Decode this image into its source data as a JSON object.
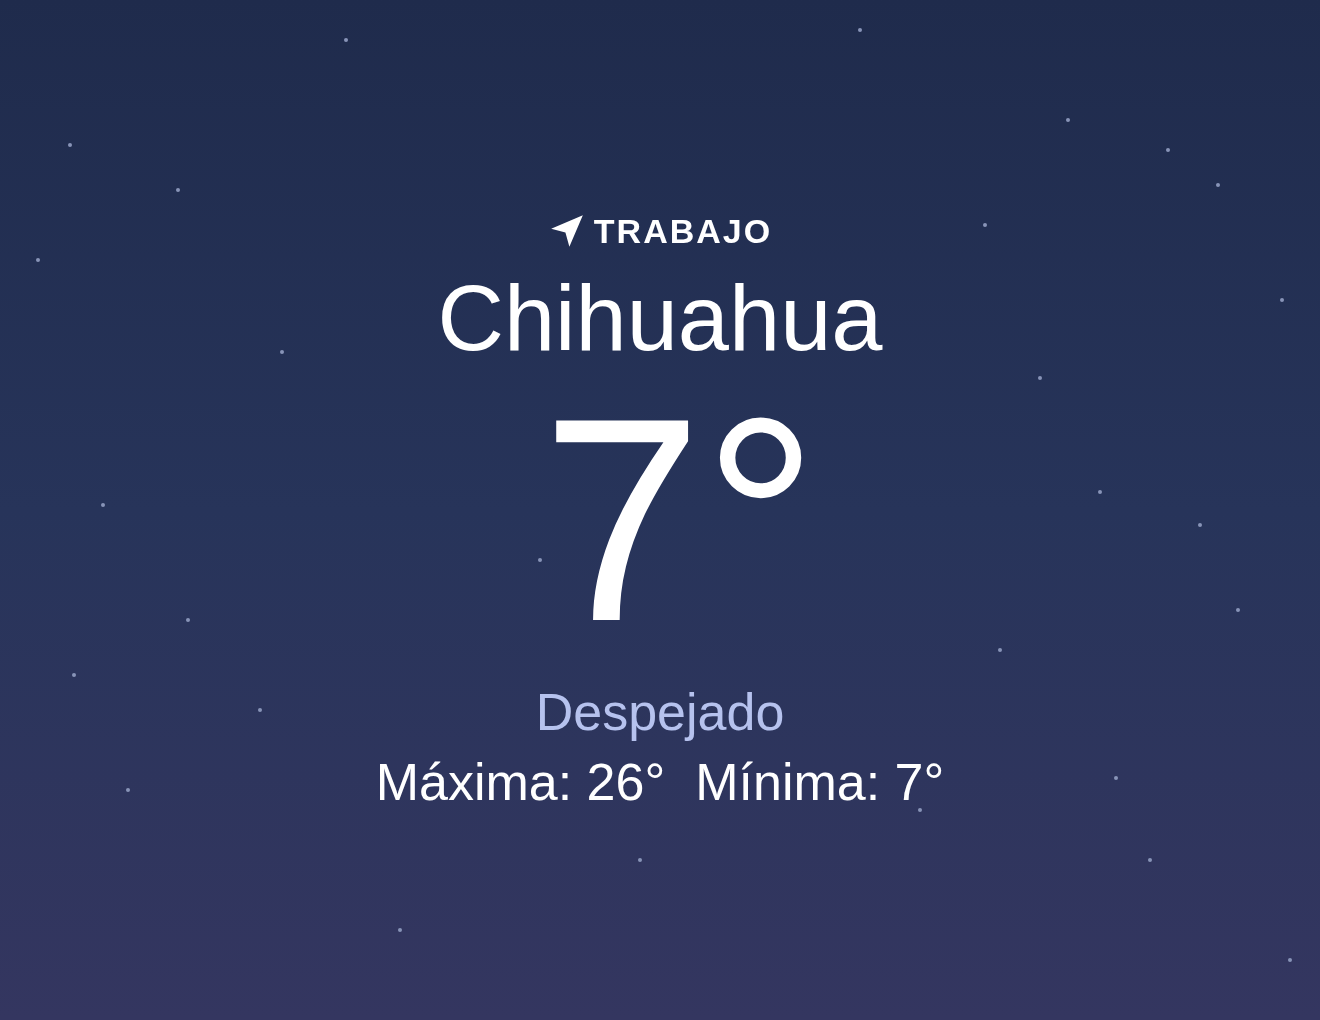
{
  "location_label": "TRABAJO",
  "city": "Chihuahua",
  "temperature": "7°",
  "condition": "Despejado",
  "high": "Máxima: 26°",
  "low": "Mínima: 7°"
}
